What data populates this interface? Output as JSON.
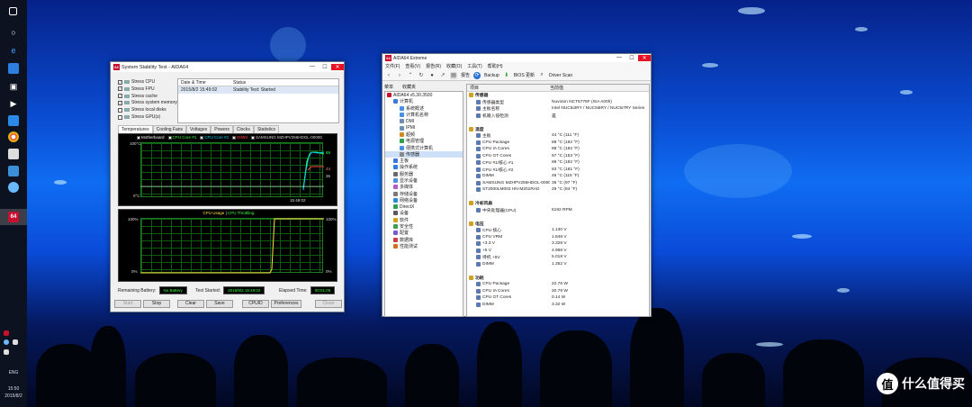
{
  "taskbar": {
    "lang": "ENG",
    "time": "15:50",
    "date": "2015/8/2",
    "app_badge": "64"
  },
  "watermark": "值 什么值得买",
  "stability": {
    "title": "System Stability Test - AIDA64",
    "checks": [
      {
        "label": "Stress CPU",
        "checked": true
      },
      {
        "label": "Stress FPU",
        "checked": true
      },
      {
        "label": "Stress cache",
        "checked": true
      },
      {
        "label": "Stress system memory",
        "checked": true
      },
      {
        "label": "Stress local disks",
        "checked": false
      },
      {
        "label": "Stress GPU(s)",
        "checked": false
      }
    ],
    "table": {
      "col1": "Date & Time",
      "col2": "Status",
      "row_date": "2015/8/2 15:49:02",
      "row_status": "Stability Test: Started"
    },
    "tabs": [
      "Temperatures",
      "Cooling Fans",
      "Voltages",
      "Powers",
      "Clocks",
      "Statistics"
    ],
    "temp_legend": [
      "Motherboard",
      "CPU Core #1",
      "CPU Core #2",
      "DIMM",
      "SAMSUNG MZHPV256HDGL-00000"
    ],
    "temp_axis": {
      "top": "100°C",
      "bottom": "0°C",
      "time": "15:49:02",
      "r1": "89",
      "r2": "44",
      "r3": "36"
    },
    "cpu_legend": {
      "usage": "CPU Usage",
      "throttling": "CPU Throttling"
    },
    "cpu_axis": {
      "top_l": "100%",
      "bottom_l": "0%",
      "top_r": "100%",
      "bottom_r": "0%"
    },
    "remaining_label": "Remaining Battery:",
    "remaining_value": "No Battery",
    "started_label": "Test Started:",
    "started_value": "2015/8/2 15:49:02",
    "elapsed_label": "Elapsed Time:",
    "elapsed_value": "00:01:05",
    "buttons": {
      "start": "Start",
      "stop": "Stop",
      "clear": "Clear",
      "save": "Save",
      "cpuid": "CPUID",
      "prefs": "Preferences",
      "close": "Close"
    }
  },
  "aida": {
    "title": "AIDA64 Extreme",
    "menu": [
      "文件(F)",
      "查看(V)",
      "报告(R)",
      "收藏(O)",
      "工具(T)",
      "帮助(H)"
    ],
    "toolbar": {
      "report": "报告",
      "backup": "Backup",
      "bios": "BIOS 更新",
      "driver": "Driver Scan"
    },
    "left_header": {
      "menu": "菜单",
      "fav": "收藏夹"
    },
    "right_header": {
      "item": "项目",
      "value": "当前值"
    },
    "tree": [
      "AIDA64 v5.30.3500",
      "计算机",
      "系统概述",
      "计算机名称",
      "DMI",
      "IPMI",
      "超频",
      "电源管理",
      "便携式计算机",
      "传感器",
      "主板",
      "操作系统",
      "服务器",
      "显示设备",
      "多媒体",
      "存储设备",
      "网络设备",
      "DirectX",
      "设备",
      "软件",
      "安全性",
      "配置",
      "数据库",
      "性能测试"
    ],
    "sensors": [
      {
        "k": "传感器",
        "v": "",
        "sec": true
      },
      {
        "k": "传感器类型",
        "v": "Nuvoton NCT6776F (ISA A00h)"
      },
      {
        "k": "主板名称",
        "v": "Intel NUC5i3RY / NUC5i5RY / NUC5i7RY Series"
      },
      {
        "k": "机箱入侵检测",
        "v": "是"
      },
      {
        "k": "",
        "v": ""
      },
      {
        "k": "温度",
        "v": "",
        "sec": true
      },
      {
        "k": "主板",
        "v": "44 °C  (111 °F)"
      },
      {
        "k": "CPU Package",
        "v": "89 °C  (192 °F)"
      },
      {
        "k": "CPU IA Cores",
        "v": "89 °C  (192 °F)"
      },
      {
        "k": "CPU GT Cores",
        "v": "67 °C  (153 °F)"
      },
      {
        "k": "CPU #1/核心 #1",
        "v": "89 °C  (192 °F)"
      },
      {
        "k": "CPU #1/核心 #2",
        "v": "83 °C  (181 °F)"
      },
      {
        "k": "DIMM",
        "v": "46 °C  (115 °F)"
      },
      {
        "k": "SAMSUNG MZHPV256HDGL-00000",
        "v": "36 °C  (97 °F)"
      },
      {
        "k": "ST2000LM003 HN-M201RAD",
        "v": "29 °C  (84 °F)"
      },
      {
        "k": "",
        "v": ""
      },
      {
        "k": "冷却风扇",
        "v": "",
        "sec": true
      },
      {
        "k": "中央处理器(CPU)",
        "v": "6192 RPM"
      },
      {
        "k": "",
        "v": ""
      },
      {
        "k": "电压",
        "v": "",
        "sec": true
      },
      {
        "k": "CPU 核心",
        "v": "1.130 V"
      },
      {
        "k": "CPU VRM",
        "v": "1.848 V"
      },
      {
        "k": "+3.3 V",
        "v": "3.328 V"
      },
      {
        "k": "+5 V",
        "v": "4.968 V"
      },
      {
        "k": "待机 +5V",
        "v": "5.018 V"
      },
      {
        "k": "DIMM",
        "v": "1.352 V"
      },
      {
        "k": "",
        "v": ""
      },
      {
        "k": "功耗",
        "v": "",
        "sec": true
      },
      {
        "k": "CPU Package",
        "v": "22.76 W"
      },
      {
        "k": "CPU IA Cores",
        "v": "20.79 W"
      },
      {
        "k": "CPU GT Cores",
        "v": "0.14 W"
      },
      {
        "k": "DIMM",
        "v": "3.32 W"
      }
    ]
  }
}
